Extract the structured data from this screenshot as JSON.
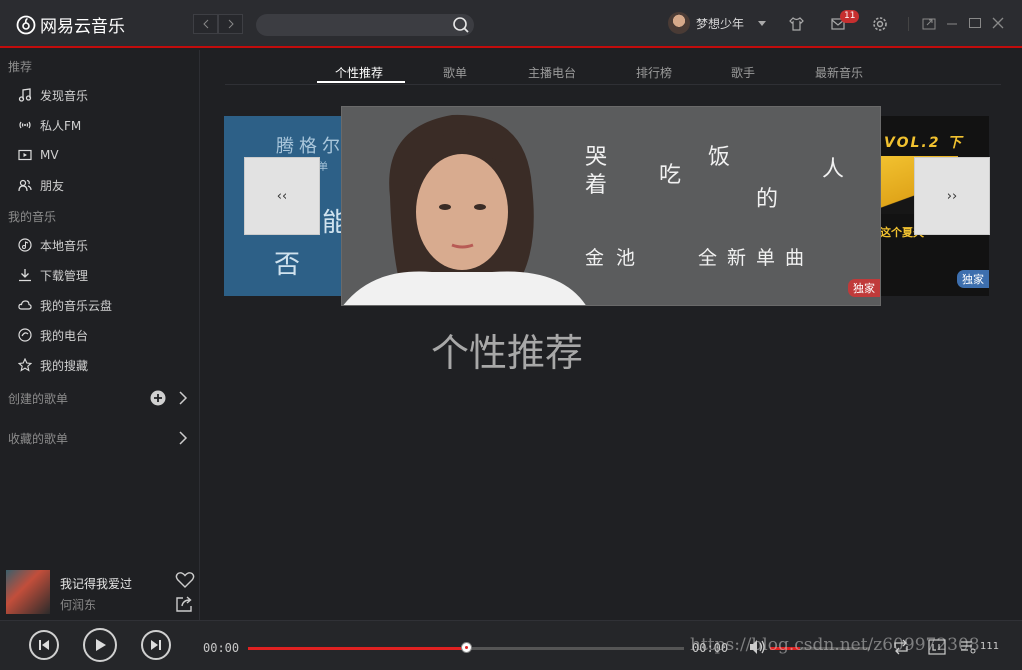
{
  "app": {
    "name": "网易云音乐"
  },
  "user": {
    "name": "梦想少年",
    "message_count": "11"
  },
  "sidebar": {
    "groups": [
      {
        "title": "推荐",
        "items": [
          {
            "label": "发现音乐",
            "icon": "music-note-icon"
          },
          {
            "label": "私人FM",
            "icon": "radio-wave-icon"
          },
          {
            "label": "MV",
            "icon": "video-icon"
          },
          {
            "label": "朋友",
            "icon": "friends-icon"
          }
        ]
      },
      {
        "title": "我的音乐",
        "items": [
          {
            "label": "本地音乐",
            "icon": "local-music-icon"
          },
          {
            "label": "下载管理",
            "icon": "download-icon"
          },
          {
            "label": "我的音乐云盘",
            "icon": "cloud-icon"
          },
          {
            "label": "我的电台",
            "icon": "my-radio-icon"
          },
          {
            "label": "我的搜藏",
            "icon": "star-icon"
          }
        ]
      }
    ],
    "created_playlists": "创建的歌单",
    "collected_playlists": "收藏的歌单"
  },
  "now_playing": {
    "title": "我记得我爱过",
    "artist": "何润东"
  },
  "tabs": [
    {
      "label": "个性推荐",
      "active": true
    },
    {
      "label": "歌单"
    },
    {
      "label": "主播电台"
    },
    {
      "label": "排行榜"
    },
    {
      "label": "歌手"
    },
    {
      "label": "最新音乐"
    }
  ],
  "banner": {
    "center": {
      "chars": [
        "哭",
        "着",
        "吃",
        "饭",
        "的",
        "人"
      ],
      "subtitle_left": "金池",
      "subtitle_right": "全新单曲",
      "tag": "独家"
    },
    "left": {
      "text_top": "腾格尔",
      "text_small": "单",
      "text_mid": "能",
      "text_bottom": "否"
    },
    "right": {
      "text_top": "VOL.2 下",
      "text_mid": "这个夏天",
      "tag": "独家"
    },
    "prev_label": "‹‹",
    "next_label": "››"
  },
  "main": {
    "heading": "个性推荐"
  },
  "player": {
    "current_time": "00:00",
    "total_time": "00:00",
    "progress": 0.5,
    "volume": 0.3,
    "playlist_count": "111"
  },
  "watermark": "https://blog.csdn.net/z609972308",
  "colors": {
    "accent": "#c20c0c",
    "progress": "#e02121"
  }
}
